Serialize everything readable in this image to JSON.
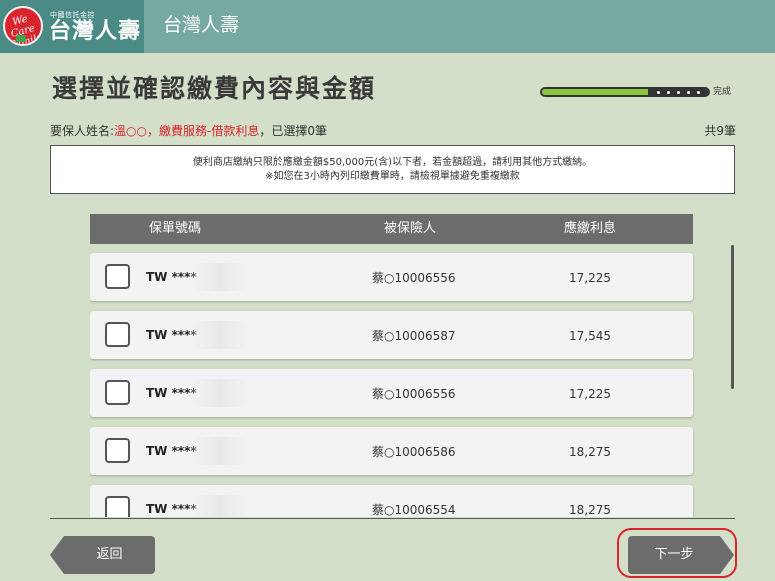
{
  "header": {
    "logo_small": "中國信託金控",
    "logo_name": "台灣人壽",
    "logo_script": "We Care Family",
    "title": "台灣人壽"
  },
  "page": {
    "title": "選擇並確認繳費內容與金額",
    "progress_label": "完成",
    "progress_fraction": 0.66
  },
  "info": {
    "holder_label": "要保人姓名:",
    "holder_name": "溫○○",
    "separator": "，",
    "service": "繳費服務-借款利息",
    "selected": "，已選擇0筆",
    "total": "共9筆"
  },
  "notice": {
    "line1": "便利商店繳納只限於應繳金額$50,000元(含)以下者，若金額超過，請利用其他方式繳納。",
    "line2": "※如您在3小時內列印繳費單時，請檢視單據避免重複繳款"
  },
  "table": {
    "headers": [
      "保單號碼",
      "被保險人",
      "應繳利息"
    ],
    "rows": [
      {
        "policy": "TW ****",
        "insured": "蔡○10006556",
        "amount": "17,225"
      },
      {
        "policy": "TW ****",
        "insured": "蔡○10006587",
        "amount": "17,545"
      },
      {
        "policy": "TW  ****",
        "insured": "蔡○10006556",
        "amount": "17,225"
      },
      {
        "policy": "TW ****",
        "insured": "蔡○10006586",
        "amount": "18,275"
      },
      {
        "policy": "TW ****",
        "insured": "蔡○10006554",
        "amount": "18,275"
      }
    ]
  },
  "buttons": {
    "back": "返回",
    "next": "下一步"
  },
  "colors": {
    "header_bg": "#77a9a2",
    "logo_bg": "#4a8b86",
    "page_bg": "#d3dfc9",
    "accent_red": "#d9242b",
    "button_gray": "#6c6c6c"
  }
}
